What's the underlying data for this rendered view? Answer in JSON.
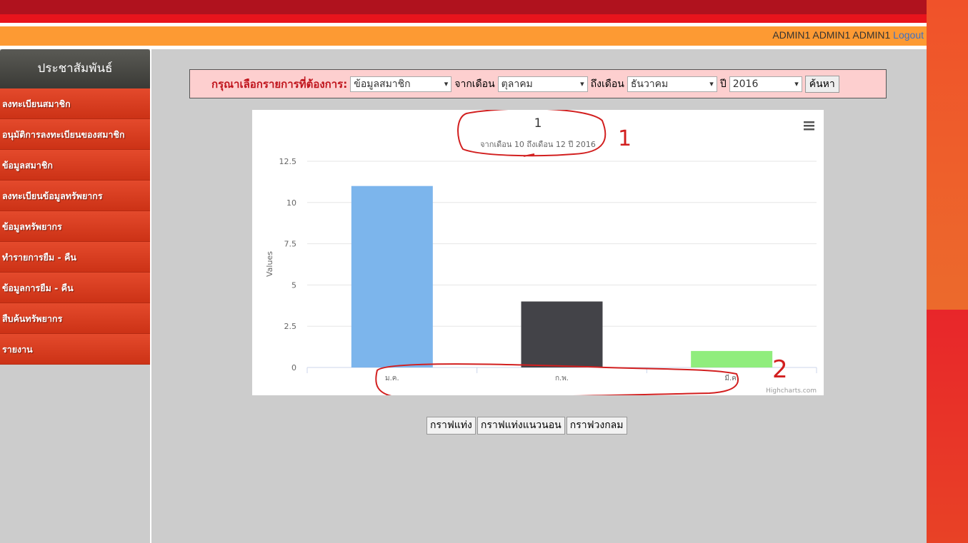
{
  "header": {
    "user": "ADMIN1 ADMIN1 ADMIN1",
    "logout": "Logout"
  },
  "sidebar": {
    "title": "ประชาสัมพันธ์",
    "items": [
      "ลงทะเบียนสมาชิก",
      "อนุมัติการลงทะเบียนของสมาชิก",
      "ข้อมูลสมาชิก",
      "ลงทะเบียนข้อมูลทรัพยากร",
      "ข้อมูลทรัพยากร",
      "ทำรายการยืม - คืน",
      "ข้อมูลการยืม - คืน",
      "สืบค้นทรัพยากร",
      "รายงาน"
    ]
  },
  "filter": {
    "label": "กรุณาเลือกรายการที่ต้องการ:",
    "type": "ข้อมูลสมาชิก",
    "from_label": "จากเดือน",
    "from": "ตุลาคม",
    "to_label": "ถึงเดือน",
    "to": "ธันวาคม",
    "year_label": "ปี",
    "year": "2016",
    "search": "ค้นหา"
  },
  "chart_data": {
    "type": "bar",
    "title": "1",
    "subtitle": "จากเดือน 10 ถึงเดือน 12 ปี 2016",
    "categories": [
      "ม.ค.",
      "ก.พ.",
      "มี.ค."
    ],
    "values": [
      11,
      4,
      1
    ],
    "colors": [
      "#7cb5ec",
      "#434348",
      "#90ed7d"
    ],
    "ylabel": "Values",
    "ylim": [
      0,
      12.5
    ],
    "yticks": [
      "0",
      "2.5",
      "5",
      "7.5",
      "10",
      "12.5"
    ],
    "credits": "Highcharts.com",
    "menu_icon": "hamburger-icon",
    "annotations": [
      "1",
      "2"
    ]
  },
  "buttons": [
    "กราฟแท่ง",
    "กราฟแท่งแนวนอน",
    "กราฟวงกลม"
  ]
}
